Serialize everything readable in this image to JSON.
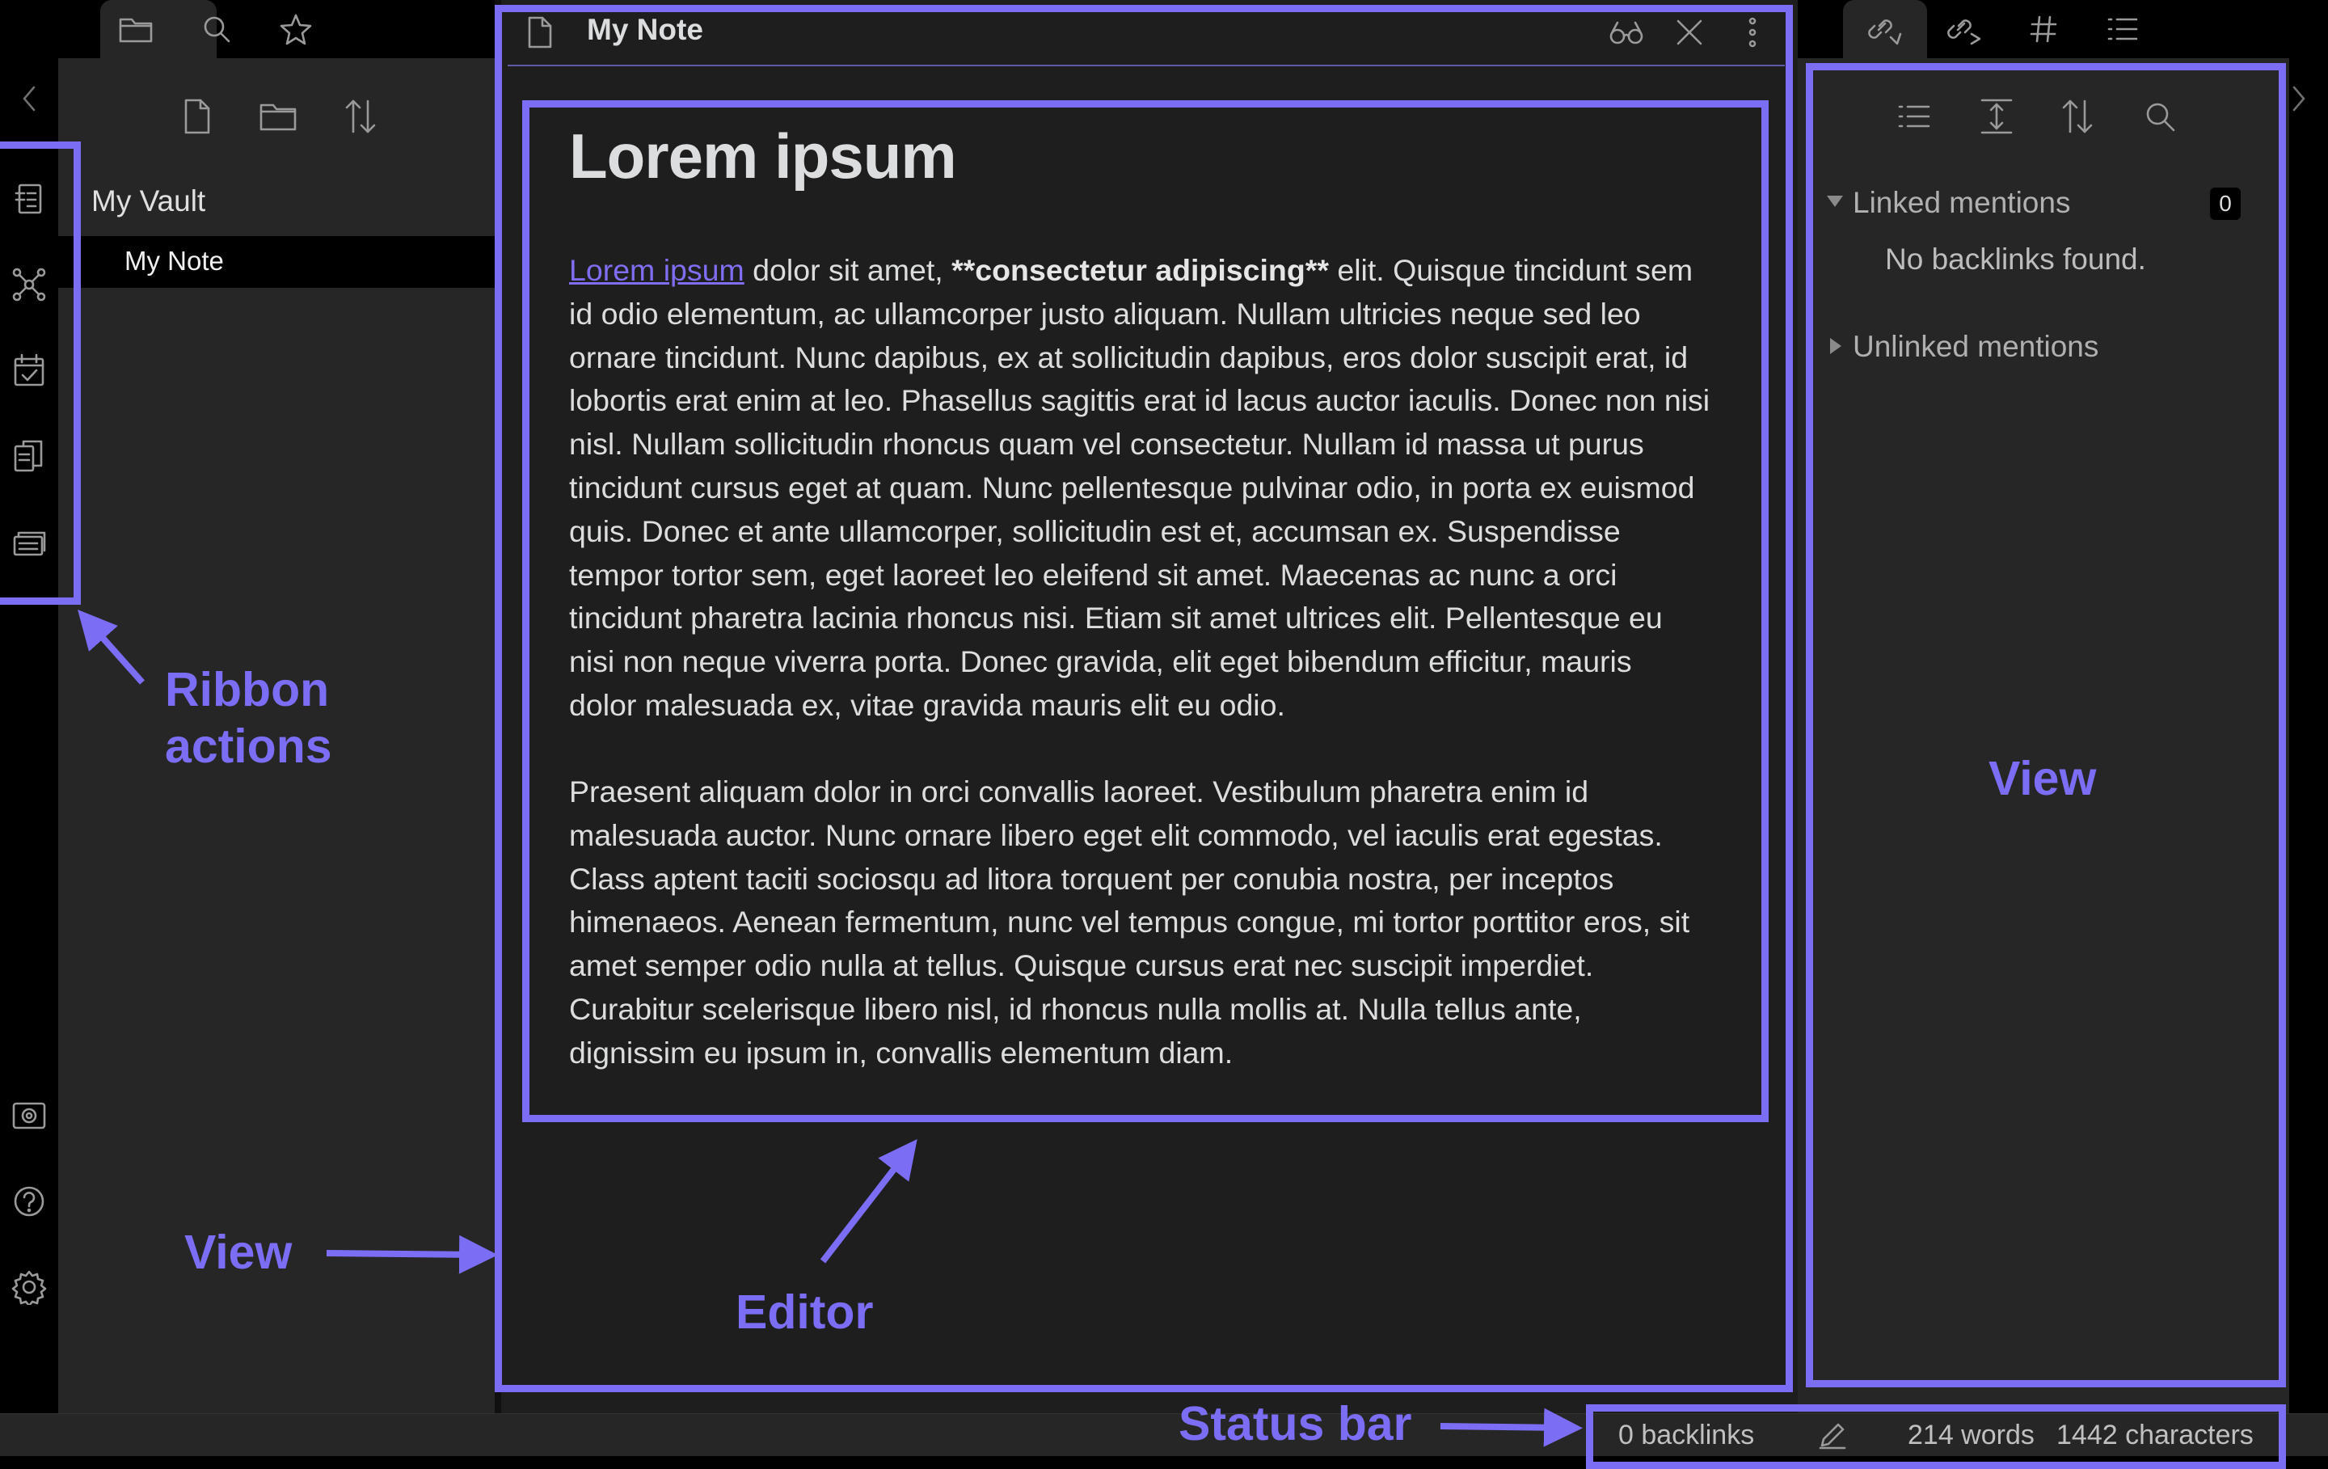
{
  "left_sidebar": {
    "tabs": [
      {
        "name": "file-explorer",
        "icon": "folder-icon"
      },
      {
        "name": "search",
        "icon": "search-icon"
      },
      {
        "name": "starred",
        "icon": "star-icon"
      }
    ],
    "toolbar": [
      "new-note-icon",
      "new-folder-icon",
      "sort-icon"
    ],
    "vault_name": "My Vault",
    "files": [
      "My Note"
    ]
  },
  "ribbon": {
    "actions": [
      "switcher-icon",
      "graph-icon",
      "daily-note-icon",
      "templates-icon",
      "slides-icon"
    ],
    "bottom_actions": [
      "vault-icon",
      "help-icon",
      "settings-icon"
    ]
  },
  "editor": {
    "tab_title": "My Note",
    "header_actions": [
      "reading-view-icon",
      "close-icon",
      "more-options-icon"
    ],
    "heading": "Lorem ipsum",
    "paragraph1": {
      "link_text": "Lorem ipsum",
      "after_link": " dolor sit amet, ",
      "bold_text": "**consectetur adipiscing**",
      "line1_rest": " elit. Quisque tincidunt sem",
      "lines": [
        "id odio elementum, ac ullamcorper justo aliquam. Nullam ultricies neque sed leo",
        "ornare tincidunt. Nunc dapibus, ex at sollicitudin dapibus, eros dolor suscipit erat, id",
        "lobortis erat enim at leo. Phasellus sagittis erat id lacus auctor iaculis. Donec non nisi",
        "nisl. Nullam sollicitudin rhoncus quam vel consectetur. Nullam id massa ut purus",
        "tincidunt cursus eget at quam. Nunc pellentesque pulvinar odio, in porta ex euismod",
        "quis. Donec et ante ullamcorper, sollicitudin est et, accumsan ex. Suspendisse",
        "tempor tortor sem, eget laoreet leo eleifend sit amet. Maecenas ac nunc a orci",
        "tincidunt pharetra lacinia rhoncus nisi. Etiam sit amet ultrices elit. Pellentesque eu",
        "nisi non neque viverra porta. Donec gravida, elit eget bibendum efficitur, mauris",
        "dolor malesuada ex, vitae gravida mauris elit eu odio."
      ]
    },
    "paragraph2": {
      "lines": [
        "Praesent aliquam dolor in orci convallis laoreet. Vestibulum pharetra enim id",
        "malesuada auctor. Nunc ornare libero eget elit commodo, vel iaculis erat egestas.",
        "Class aptent taciti sociosqu ad litora torquent per conubia nostra, per inceptos",
        "himenaeos. Aenean fermentum, nunc vel tempus congue, mi tortor porttitor eros, sit",
        "amet semper odio nulla at tellus. Quisque cursus erat nec suscipit imperdiet.",
        "Curabitur scelerisque libero nisl, id rhoncus nulla mollis at. Nulla tellus ante,",
        "dignissim eu ipsum in, convallis elementum diam."
      ]
    }
  },
  "right_sidebar": {
    "tabs": [
      {
        "name": "backlinks",
        "icon": "backlinks-icon"
      },
      {
        "name": "outgoing-links",
        "icon": "outgoing-links-icon"
      },
      {
        "name": "tags",
        "icon": "hash-icon"
      },
      {
        "name": "outline",
        "icon": "outline-icon"
      }
    ],
    "toolbar": [
      "list-icon",
      "expand-icon",
      "sort-icon",
      "search-icon"
    ],
    "linked_mentions": {
      "label": "Linked mentions",
      "count": "0",
      "empty_text": "No backlinks found."
    },
    "unlinked_mentions": {
      "label": "Unlinked mentions"
    }
  },
  "status_bar": {
    "backlinks": "0 backlinks",
    "edit_icon": "pencil-icon",
    "words": "214 words",
    "characters": "1442 characters"
  },
  "annotations": {
    "ribbon_actions": [
      "Ribbon",
      "actions"
    ],
    "view_left": "View",
    "editor": "Editor",
    "view_right": "View",
    "status_bar": "Status bar",
    "accent_color": "#7b6ef5"
  }
}
